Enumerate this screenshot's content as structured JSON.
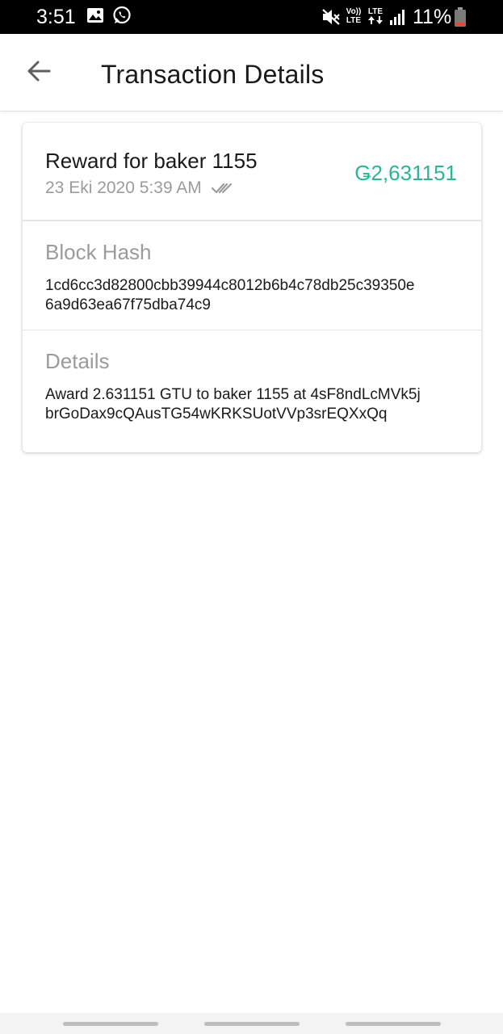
{
  "status_bar": {
    "time": "3:51",
    "battery": "11%",
    "icons": [
      "image-icon",
      "whatsapp-icon",
      "mute-icon",
      "volte-icon",
      "lte-icon",
      "signal-icon",
      "battery-icon"
    ],
    "volte_label_top": "Vo))",
    "volte_label_bottom": "LTE",
    "lte_label": "LTE"
  },
  "app_bar": {
    "title": "Transaction Details",
    "back_icon": "arrow-left-icon"
  },
  "transaction": {
    "title": "Reward for baker 1155",
    "date": "23 Eki 2020 5:39 AM",
    "status_icon": "double-check-icon",
    "amount": "Ǥ2,631151",
    "amount_color": "#2bb69a"
  },
  "block_hash": {
    "label": "Block Hash",
    "value_line1": "1cd6cc3d82800cbb39944c8012b6b4c78db25c39350e",
    "value_line2": "6a9d63ea67f75dba74c9"
  },
  "details": {
    "label": "Details",
    "value_line1": "Award 2.631151 GTU to baker 1155 at 4sF8ndLcMVk5j",
    "value_line2": "brGoDax9cQAusTG54wKRKSUotVVp3srEQXxQq"
  }
}
